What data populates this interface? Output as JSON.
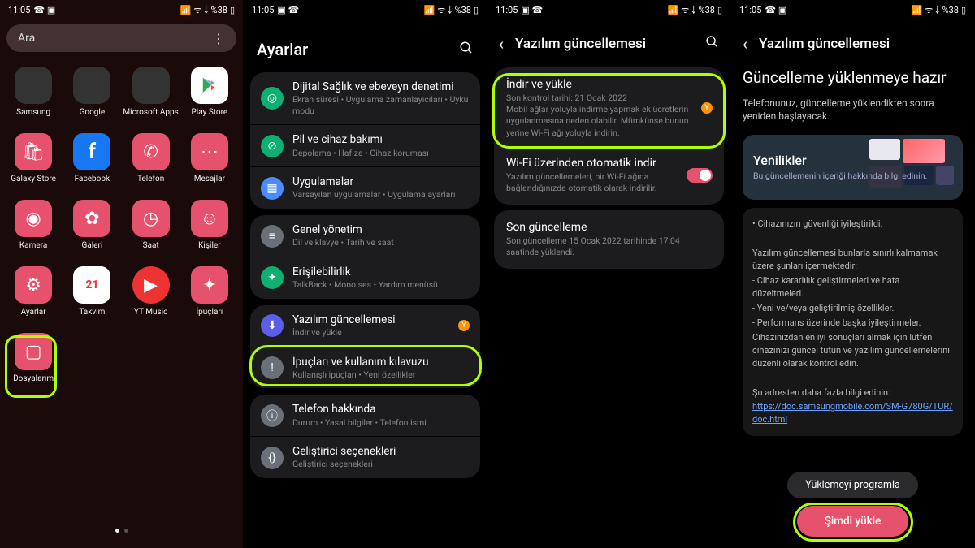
{
  "status": {
    "time": "11:05",
    "battery": "%38",
    "net_icons": "📞 📶"
  },
  "p1": {
    "search_placeholder": "Ara",
    "apps": [
      {
        "label": "Samsung",
        "key": "folder-samsung"
      },
      {
        "label": "Google",
        "key": "folder-google"
      },
      {
        "label": "Microsoft Apps",
        "key": "folder-ms"
      },
      {
        "label": "Play Store",
        "key": "play-store"
      },
      {
        "label": "Galaxy Store",
        "key": "galaxy-store"
      },
      {
        "label": "Facebook",
        "key": "facebook"
      },
      {
        "label": "Telefon",
        "key": "phone"
      },
      {
        "label": "Mesajlar",
        "key": "messages"
      },
      {
        "label": "Kamera",
        "key": "camera"
      },
      {
        "label": "Galeri",
        "key": "gallery"
      },
      {
        "label": "Saat",
        "key": "clock"
      },
      {
        "label": "Kişiler",
        "key": "contacts"
      },
      {
        "label": "Ayarlar",
        "key": "settings"
      },
      {
        "label": "Takvim",
        "key": "calendar"
      },
      {
        "label": "YT Music",
        "key": "yt-music"
      },
      {
        "label": "İpuçları",
        "key": "tips"
      },
      {
        "label": "Dosyalarım",
        "key": "files"
      }
    ],
    "calendar_day": "21"
  },
  "p2": {
    "title": "Ayarlar",
    "groups": [
      [
        {
          "key": "digital",
          "ico": "#0fae72",
          "glyph": "◎",
          "title": "Dijital Sağlık ve ebeveyn denetimi",
          "sub": "Ekran süresi  •  Uygulama zamanlayıcıları  •  Uyku modu"
        },
        {
          "key": "battery",
          "ico": "#0fae72",
          "glyph": "⊘",
          "title": "Pil ve cihaz bakımı",
          "sub": "Depolama  •  Hafıza  •  Cihaz koruması"
        },
        {
          "key": "apps",
          "ico": "#4a8cff",
          "glyph": "▦",
          "title": "Uygulamalar",
          "sub": "Varsayılan uygulamalar  •  Uygulama ayarları"
        }
      ],
      [
        {
          "key": "general",
          "ico": "#6b6f78",
          "glyph": "≡",
          "title": "Genel yönetim",
          "sub": "Dil ve klavye  •  Tarih ve saat"
        },
        {
          "key": "access",
          "ico": "#0fae72",
          "glyph": "✦",
          "title": "Erişilebilirlik",
          "sub": "TalkBack  •  Mono ses  •  Yardım menüsü"
        }
      ],
      [
        {
          "key": "update",
          "ico": "#5b5ee6",
          "glyph": "⬇",
          "title": "Yazılım güncellemesi",
          "sub": "İndir ve yükle",
          "badge": "Y"
        },
        {
          "key": "tips",
          "ico": "#6b6f78",
          "glyph": "!",
          "title": "İpuçları ve kullanım kılavuzu",
          "sub": "Kullanışlı ipuçları  •  Yeni özellikler"
        }
      ],
      [
        {
          "key": "about",
          "ico": "#6b6f78",
          "glyph": "ⓘ",
          "title": "Telefon hakkında",
          "sub": "Durum  •  Yasal bilgiler  •  Telefon ismi"
        },
        {
          "key": "dev",
          "ico": "#6b6f78",
          "glyph": "{}",
          "title": "Geliştirici seçenekleri",
          "sub": "Geliştirici seçenekleri"
        }
      ]
    ]
  },
  "p3": {
    "title": "Yazılım güncellemesi",
    "items": [
      {
        "key": "download",
        "title": "İndir ve yükle",
        "sub": "Son kontrol tarihi: 21 Ocak 2022\nMobil ağlar yoluyla indirme yapmak ek ücretlerin uygulanmasına neden olabilir. Mümkünse bunun yerine Wi-Fi ağı yoluyla indirin.",
        "badge": "Y"
      },
      {
        "key": "autowifi",
        "title": "Wi-Fi üzerinden otomatik indir",
        "sub": "Yazılım güncellemeleri, bir Wi-Fi ağına bağlandığınızda otomatik olarak indirilir.",
        "toggle": true
      }
    ],
    "last": {
      "title": "Son güncelleme",
      "sub": "Son güncelleme 15 Ocak 2022 tarihinde 17:04 saatinde yüklendi."
    }
  },
  "p4": {
    "header": "Yazılım güncellemesi",
    "title": "Güncelleme yüklenmeye hazır",
    "desc": "Telefonunuz, güncelleme yüklendikten sonra yeniden başlayacak.",
    "whatsnew_title": "Yenilikler",
    "whatsnew_sub": "Bu güncellemenin içeriği hakkında bilgi edinin.",
    "notes": [
      "• Cihazınızın güvenliği iyileştirildi.",
      "",
      "Yazılım güncellemesi bunlarla sınırlı kalmamak üzere şunları içermektedir:",
      " - Cihaz kararlılık geliştirmeleri ve hata düzeltmeleri.",
      " - Yeni ve/veya geliştirilmiş özellikler.",
      " - Performans üzerinde başka iyileştirmeler.",
      "Cihazınızdan en iyi sonuçları almak için lütfen cihazınızı güncel tutun ve yazılım güncellemelerini düzenli olarak kontrol edin.",
      "",
      "Şu adresten daha fazla bilgi edinin:"
    ],
    "link": "https://doc.samsungmobile.com/SM-G780G/TUR/doc.html",
    "btn_schedule": "Yüklemeyi programla",
    "btn_install": "Şimdi yükle"
  }
}
